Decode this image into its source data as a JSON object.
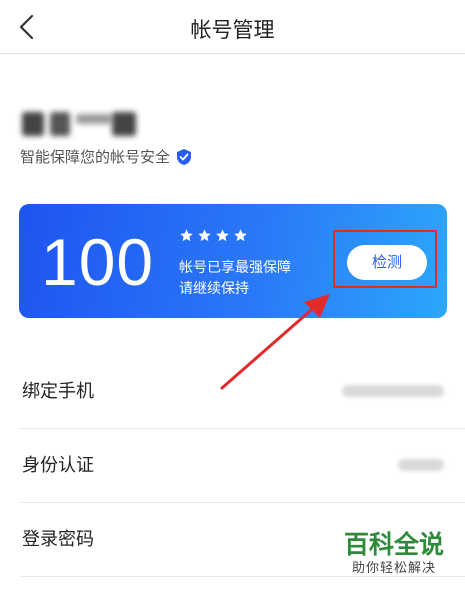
{
  "header": {
    "title": "帐号管理",
    "back_icon": "chevron-left-icon"
  },
  "account": {
    "security_text": "智能保障您的帐号安全",
    "verified_icon": "shield-check-icon",
    "accent_color": "#2a5ef2"
  },
  "score_card": {
    "score": "100",
    "stars": 4,
    "status_line1": "帐号已享最强保障",
    "status_line2": "请继续保持",
    "check_label": "检测",
    "gradient_start": "#1e54f0",
    "gradient_end": "#2ca7fb"
  },
  "annotation": {
    "highlight_color": "#e22a2a"
  },
  "menu": {
    "items": [
      {
        "label": "绑定手机"
      },
      {
        "label": "身份认证"
      },
      {
        "label": "登录密码"
      }
    ]
  },
  "watermark": {
    "title": "百科全说",
    "subtitle": "助你轻松解决"
  }
}
